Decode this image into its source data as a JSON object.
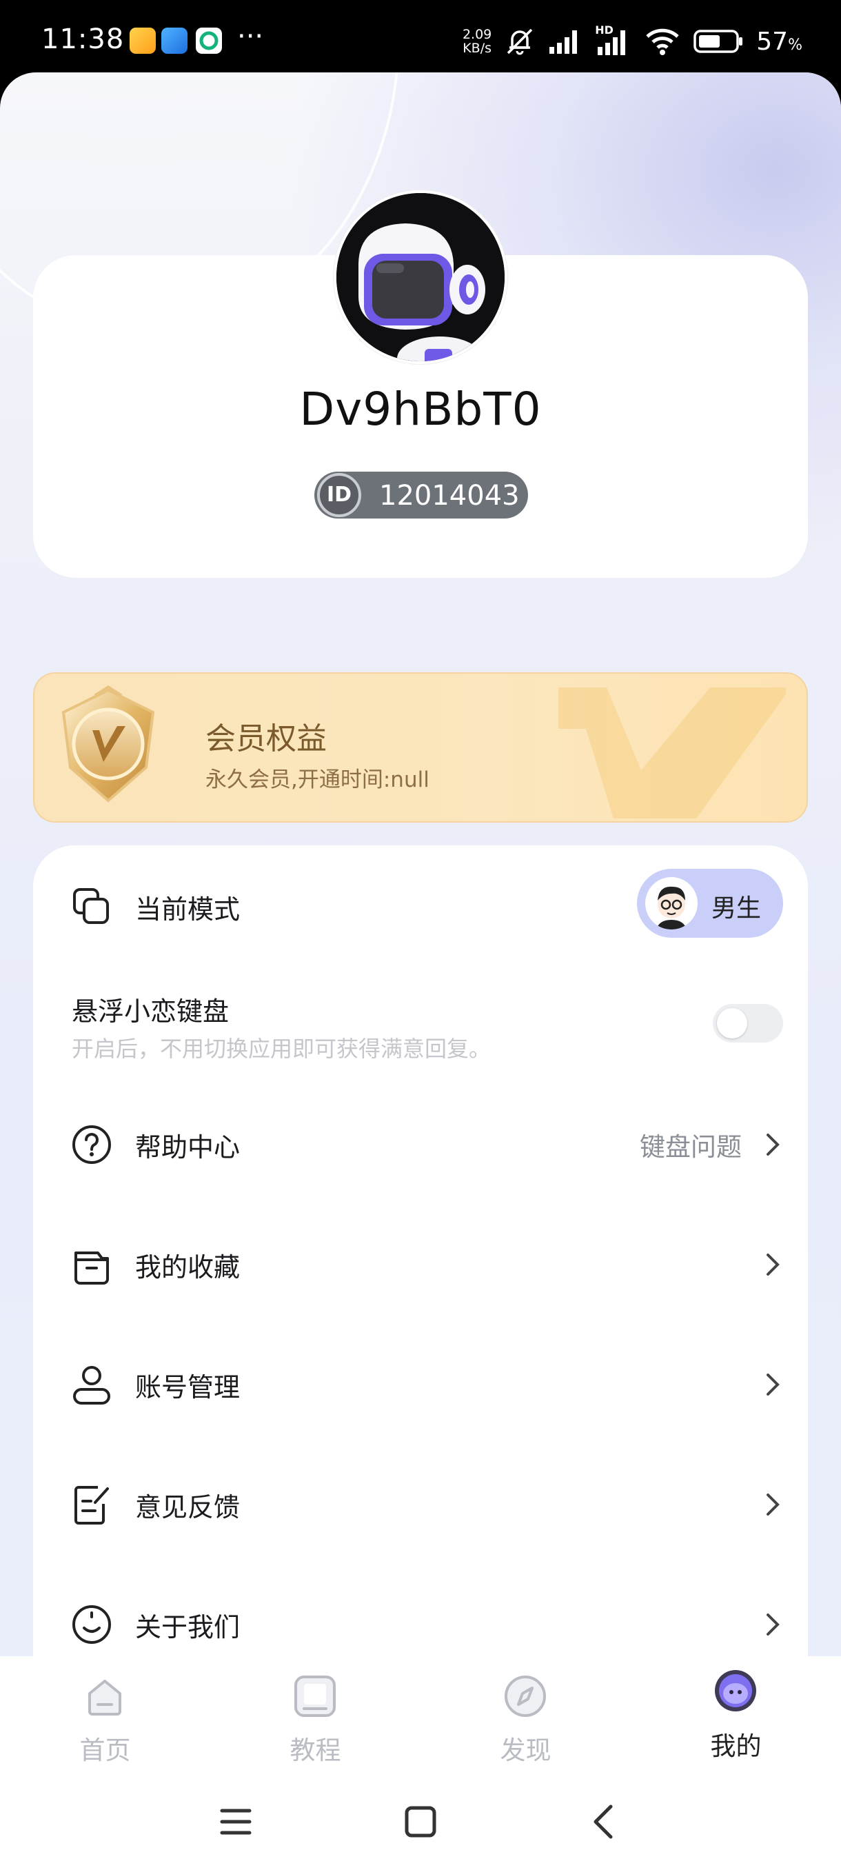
{
  "status_bar": {
    "time": "11:38",
    "more": "···",
    "net_speed_value": "2.09",
    "net_speed_unit": "KB/s",
    "battery_percent": "57",
    "battery_unit": "%",
    "hd_label": "HD"
  },
  "profile": {
    "username": "Dv9hBbT0",
    "id_badge": "ID",
    "id_number": "12014043"
  },
  "vip": {
    "title": "会员权益",
    "subtitle": "永久会员,开通时间:null"
  },
  "menu": {
    "current_mode": {
      "label": "当前模式",
      "gender": "男生"
    },
    "float_keyboard": {
      "label": "悬浮小恋键盘",
      "desc": "开启后，不用切换应用即可获得满意回复。",
      "enabled": false
    },
    "help": {
      "label": "帮助中心",
      "extra": "键盘问题"
    },
    "favorites": {
      "label": "我的收藏"
    },
    "account": {
      "label": "账号管理"
    },
    "feedback": {
      "label": "意见反馈"
    },
    "about": {
      "label": "关于我们"
    }
  },
  "tabs": [
    {
      "label": "首页",
      "icon": "home-icon",
      "active": false
    },
    {
      "label": "教程",
      "icon": "tutorial-icon",
      "active": false
    },
    {
      "label": "发现",
      "icon": "compass-icon",
      "active": false
    },
    {
      "label": "我的",
      "icon": "profile-icon",
      "active": true
    }
  ],
  "colors": {
    "accent": "#5c54e0",
    "gender_pill": "#c9cff8",
    "vip_gold": "#fbe4b9"
  }
}
